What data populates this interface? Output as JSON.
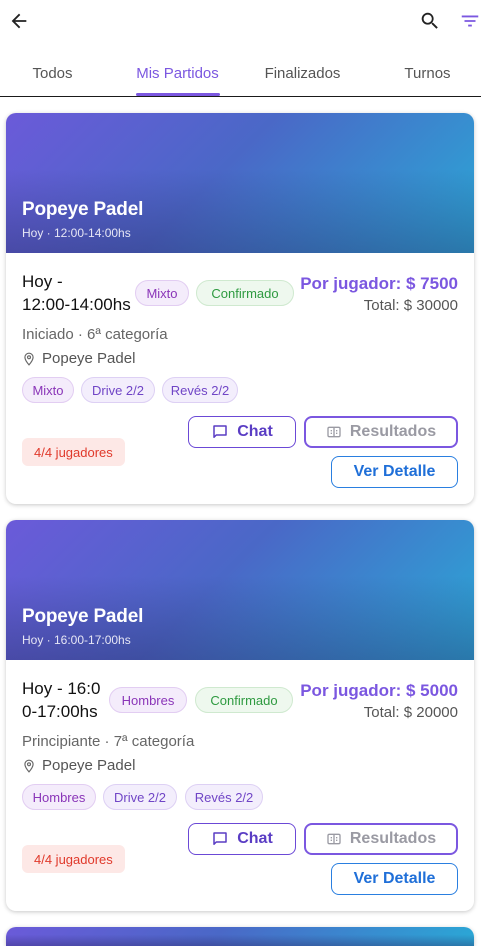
{
  "tabs": [
    {
      "label": "Todos"
    },
    {
      "label": "Mis Partidos"
    },
    {
      "label": "Finalizados"
    },
    {
      "label": "Turnos"
    }
  ],
  "active_tab": "Mis Partidos",
  "icons": {
    "back": "arrow-back-icon",
    "search": "search-icon",
    "filter": "filter-icon"
  },
  "colors": {
    "accent": "#7b57e0",
    "confirmed": "#2e9a40",
    "players_alert": "#e0392b",
    "detail_button": "#1f6fd8"
  },
  "matches": [
    {
      "venue": "Popeye Padel",
      "venue_time": "Hoy · 12:00-14:00hs",
      "time_line1": "Hoy -",
      "time_line2": "12:00-14:00hs",
      "gender_pill": "Mixto",
      "status_pill": "Confirmado",
      "price": "Por jugador: $ 7500",
      "total": "Total: $ 30000",
      "level": "Iniciado · 6ª categoría",
      "location": "Popeye Padel",
      "tags": [
        "Mixto",
        "Drive 2/2",
        "Revés 2/2"
      ],
      "players": "4/4 jugadores",
      "chat_label": "Chat",
      "results_label": "Resultados",
      "detail_label": "Ver Detalle"
    },
    {
      "venue": "Popeye Padel",
      "venue_time": "Hoy · 16:00-17:00hs",
      "time_line1": "Hoy - 16:0",
      "time_line2": "0-17:00hs",
      "gender_pill": "Hombres",
      "status_pill": "Confirmado",
      "price": "Por jugador: $ 5000",
      "total": "Total: $ 20000",
      "level": "Principiante · 7ª categoría",
      "location": "Popeye Padel",
      "tags": [
        "Hombres",
        "Drive 2/2",
        "Revés 2/2"
      ],
      "players": "4/4 jugadores",
      "chat_label": "Chat",
      "results_label": "Resultados",
      "detail_label": "Ver Detalle"
    }
  ]
}
